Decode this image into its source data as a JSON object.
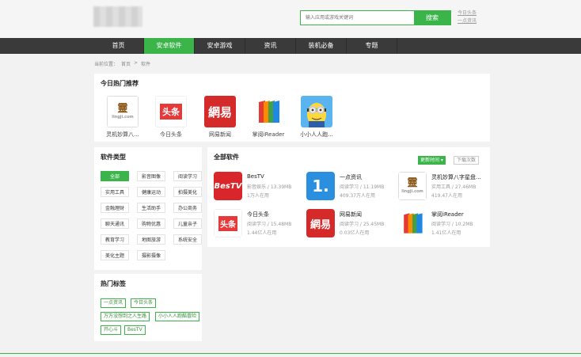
{
  "header": {
    "search_placeholder": "输入应用或游戏关键词",
    "search_button": "搜索",
    "hot_links": [
      "今日头条",
      "一点资讯"
    ]
  },
  "nav": {
    "items": [
      "首页",
      "安卓软件",
      "安卓游戏",
      "资讯",
      "装机必备",
      "专题"
    ],
    "active": "安卓软件"
  },
  "breadcrumb": {
    "prefix": "当前位置：",
    "home": "首页",
    "sep": ">",
    "current": "软件"
  },
  "recommend": {
    "title": "今日热门推荐",
    "apps": [
      {
        "name": "灵机妙算八...",
        "icon": "lingji-icon"
      },
      {
        "name": "今日头条",
        "icon": "toutiao-icon"
      },
      {
        "name": "网易新闻",
        "icon": "netease-icon"
      },
      {
        "name": "掌阅iReader",
        "icon": "ireader-icon"
      },
      {
        "name": "小小人人跑...",
        "icon": "minion-icon"
      }
    ]
  },
  "categories": {
    "title": "软件类型",
    "items": [
      "全部",
      "影音图像",
      "阅读学习",
      "实用工具",
      "健康运动",
      "拍摄美化",
      "金融理财",
      "生活助手",
      "办公商务",
      "聊天通讯",
      "购物优惠",
      "儿童亲子",
      "教育学习",
      "地图旅游",
      "系统安全",
      "美化主题",
      "摄影摄像"
    ],
    "active": "全部"
  },
  "tags": {
    "title": "热门标签",
    "items": [
      "一点资讯",
      "今日头条",
      "万万没想到之人生路",
      "小小人人跑酷冒险",
      "开心斗",
      "BesTV"
    ]
  },
  "all_software": {
    "title": "全部软件",
    "sort_new": "更新时间 ▾",
    "sort_downloads": "下载次数",
    "apps": [
      {
        "name": "BesTV",
        "category": "影音娱乐",
        "size": "13.39MB",
        "count": "1万人在用",
        "icon": "bestv-icon"
      },
      {
        "name": "一点资讯",
        "category": "阅读学习",
        "size": "11.19MB",
        "count": "409.37万人在用",
        "icon": "yidian-icon"
      },
      {
        "name": "灵机妙算八字星盘...",
        "category": "实用工具",
        "size": "27.46MB",
        "count": "419.47人在用",
        "icon": "lingji-icon"
      },
      {
        "name": "今日头条",
        "category": "阅读学习",
        "size": "15.48MB",
        "count": "1.44亿人在用",
        "icon": "toutiao-icon"
      },
      {
        "name": "网易新闻",
        "category": "阅读学习",
        "size": "25.45MB",
        "count": "0.03亿人在用",
        "icon": "netease-icon"
      },
      {
        "name": "掌阅iReader",
        "category": "阅读学习",
        "size": "10.2MB",
        "count": "1.41亿人在用",
        "icon": "ireader-icon"
      }
    ]
  },
  "colors": {
    "accent": "#3bb54a",
    "nav_bg": "#3a3a3a",
    "page_bg": "#f2f2f2"
  }
}
